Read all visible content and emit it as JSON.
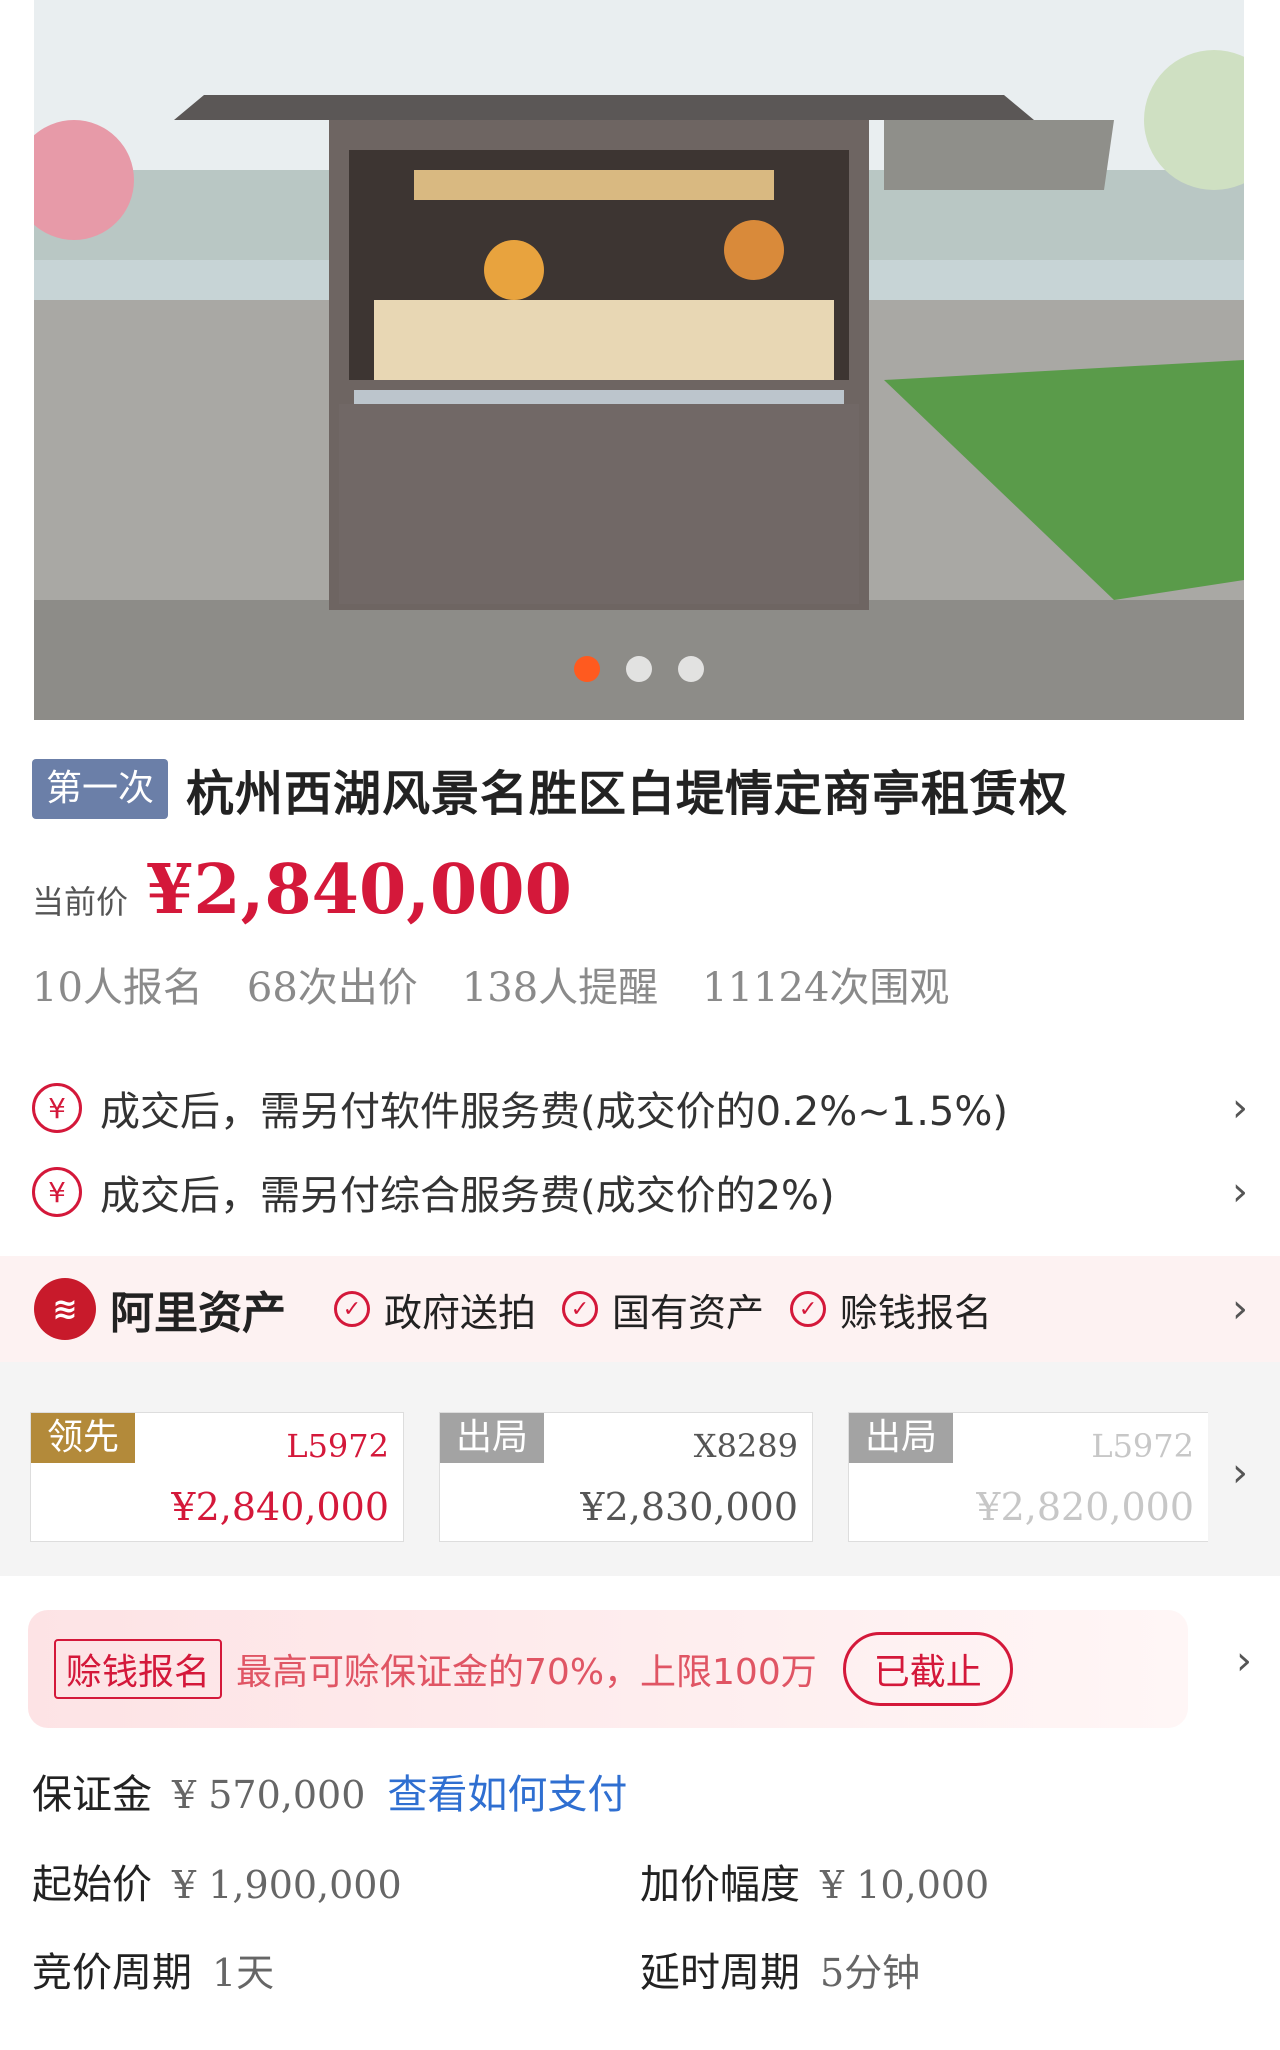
{
  "gallery": {
    "slide_count": 3,
    "active_index": 0
  },
  "title": {
    "round_tag": "第一次",
    "text": "杭州西湖风景名胜区白堤情定商亭租赁权"
  },
  "price": {
    "label": "当前价",
    "value": "¥2,840,000"
  },
  "stats": [
    "10人报名",
    "68次出价",
    "138人提醒",
    "11124次围观"
  ],
  "fees": [
    {
      "icon": "yen-icon",
      "text": "成交后，需另付软件服务费(成交价的0.2%~1.5%)"
    },
    {
      "icon": "yen-icon",
      "text": "成交后，需另付综合服务费(成交价的2%)"
    }
  ],
  "platform": {
    "name": "阿里资产",
    "badges": [
      "政府送拍",
      "国有资产",
      "赊钱报名"
    ]
  },
  "bids": [
    {
      "status": "领先",
      "user": "L5972",
      "amount": "¥2,840,000"
    },
    {
      "status": "出局",
      "user": "X8289",
      "amount": "¥2,830,000"
    },
    {
      "status": "出局",
      "user": "L5972",
      "amount": "¥2,820,000"
    }
  ],
  "loan": {
    "tag": "赊钱报名",
    "text": "最高可赊保证金的70%，上限100万",
    "status": "已截止"
  },
  "details": {
    "deposit_label": "保证金",
    "deposit_value": "¥ 570,000",
    "deposit_link": "查看如何支付",
    "start_label": "起始价",
    "start_value": "¥ 1,900,000",
    "increment_label": "加价幅度",
    "increment_value": "¥ 10,000",
    "cycle_label": "竞价周期",
    "cycle_value": "1天",
    "delay_label": "延时周期",
    "delay_value": "5分钟"
  },
  "colors": {
    "accent": "#d4183a",
    "link": "#2f6fd1",
    "lead_tag": "#b38a3a",
    "out_tag": "#a3a3a3",
    "round_tag": "#6b7fa8"
  }
}
